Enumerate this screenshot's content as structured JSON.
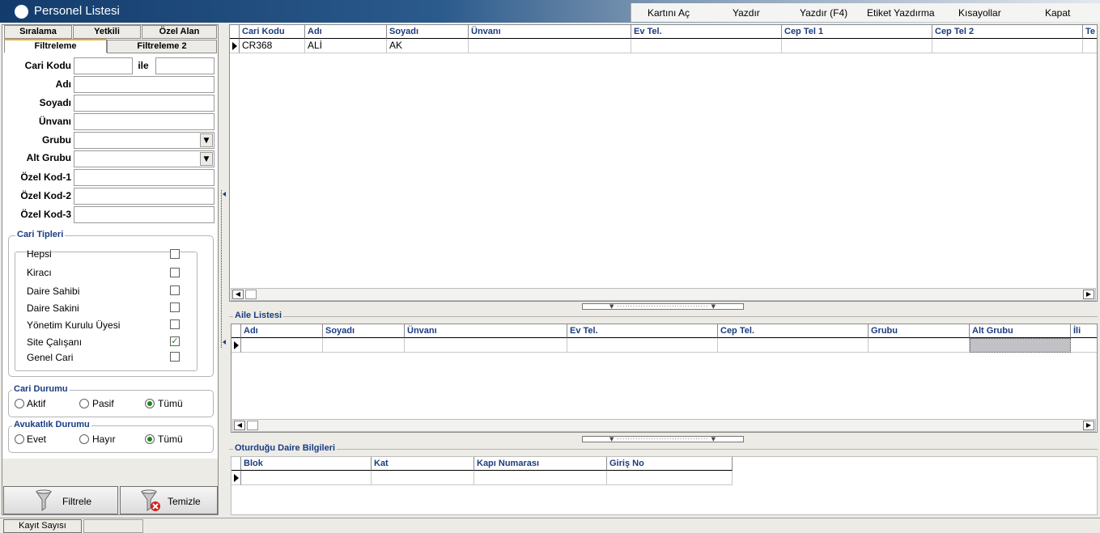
{
  "window": {
    "title": "Personel Listesi"
  },
  "menu": [
    {
      "label": "Kartını Aç"
    },
    {
      "label": "Yazdır"
    },
    {
      "label": "Yazdır (F4)"
    },
    {
      "label": "Etiket Yazdırma"
    },
    {
      "label": "Kısayollar"
    },
    {
      "label": "Kapat"
    }
  ],
  "tabs_row1": [
    "Sıralama",
    "Yetkili",
    "Özel Alan"
  ],
  "tabs_row2": [
    "Filtreleme",
    "Filtreleme 2"
  ],
  "filter": {
    "cari_kodu": "Cari Kodu",
    "ile": "ile",
    "adi": "Adı",
    "soyadi": "Soyadı",
    "unvani": "Ünvanı",
    "grubu": "Grubu",
    "alt_grubu": "Alt Grubu",
    "ozel_kod1": "Özel Kod-1",
    "ozel_kod2": "Özel Kod-2",
    "ozel_kod3": "Özel Kod-3"
  },
  "cari_tipleri": {
    "title": "Cari Tipleri",
    "items": [
      {
        "label": "Hepsi",
        "checked": false
      },
      {
        "label": "Kiracı",
        "checked": false
      },
      {
        "label": "Daire Sahibi",
        "checked": false
      },
      {
        "label": "Daire Sakini",
        "checked": false
      },
      {
        "label": "Yönetim Kurulu Üyesi",
        "checked": false
      },
      {
        "label": "Site Çalışanı",
        "checked": true
      },
      {
        "label": "Genel Cari",
        "checked": false
      }
    ]
  },
  "cari_durumu": {
    "title": "Cari Durumu",
    "options": [
      {
        "label": "Aktif",
        "selected": false
      },
      {
        "label": "Pasif",
        "selected": false
      },
      {
        "label": "Tümü",
        "selected": true
      }
    ]
  },
  "avukatlik_durumu": {
    "title": "Avukatlık Durumu",
    "options": [
      {
        "label": "Evet",
        "selected": false
      },
      {
        "label": "Hayır",
        "selected": false
      },
      {
        "label": "Tümü",
        "selected": true
      }
    ]
  },
  "buttons": {
    "filtrele": "Filtrele",
    "temizle": "Temizle"
  },
  "main_grid": {
    "columns": [
      "Cari Kodu",
      "Adı",
      "Soyadı",
      "Ünvanı",
      "Ev Tel.",
      "Cep Tel 1",
      "Cep Tel 2",
      "Te"
    ],
    "rows": [
      [
        "CR368",
        "ALİ",
        "AK",
        "",
        "",
        "",
        "",
        ""
      ]
    ]
  },
  "aile": {
    "title": "Aile Listesi",
    "columns": [
      "Adı",
      "Soyadı",
      "Ünvanı",
      "Ev Tel.",
      "Cep Tel.",
      "Grubu",
      "Alt Grubu",
      "İli"
    ]
  },
  "daire": {
    "title": "Oturduğu Daire Bilgileri",
    "columns": [
      "Blok",
      "Kat",
      "Kapı Numarası",
      "Giriş No"
    ]
  },
  "status": {
    "kayit_sayisi": "Kayıt Sayısı"
  },
  "colors": {
    "accent_tab": "#f5a623",
    "header_text": "#1a3c80",
    "title_dark": "#133c6c",
    "check_green": "#1a8a1a"
  }
}
